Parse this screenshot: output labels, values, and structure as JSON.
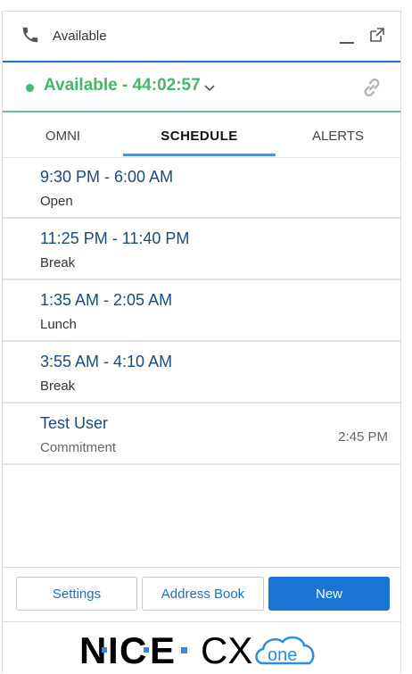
{
  "titlebar": {
    "title": "Available",
    "icons": {
      "phone": "phone-icon",
      "minimize": "minimize-icon",
      "popout": "popout-icon"
    }
  },
  "status": {
    "text": "Available - 44:02:57",
    "color": "#3cbf6e",
    "icons": {
      "chevron": "chevron-down-icon",
      "link": "link-icon"
    }
  },
  "tabs": [
    {
      "label": "OMNI",
      "active": false
    },
    {
      "label": "SCHEDULE",
      "active": true
    },
    {
      "label": "ALERTS",
      "active": false
    }
  ],
  "schedule": [
    {
      "time": "9:30 PM - 6:00 AM",
      "label": "Open"
    },
    {
      "time": "11:25 PM - 11:40 PM",
      "label": "Break"
    },
    {
      "time": "1:35 AM - 2:05 AM",
      "label": "Lunch"
    },
    {
      "time": "3:55 AM - 4:10 AM",
      "label": "Break"
    },
    {
      "time": "Test User",
      "label": "Commitment",
      "right_time": "2:45 PM"
    }
  ],
  "footer": {
    "settings_label": "Settings",
    "address_book_label": "Address Book",
    "new_label": "New"
  },
  "branding": {
    "logo_text": "NICE · CXone",
    "colors": {
      "accent": "#1a74d4",
      "status_green": "#41b86a",
      "link_blue": "#1d4b79"
    }
  }
}
